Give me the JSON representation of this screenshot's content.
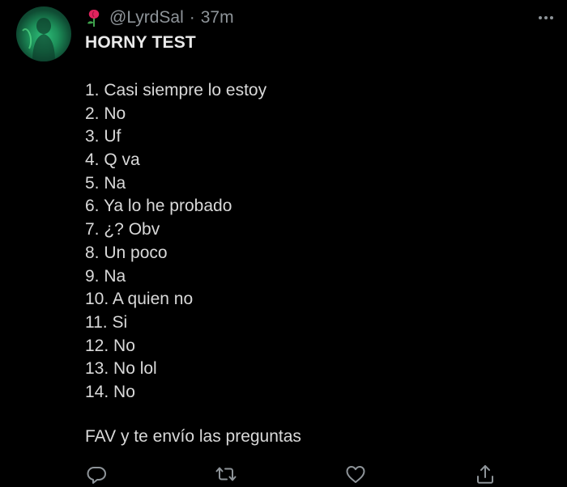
{
  "tweet": {
    "avatar_icon": "user-avatar",
    "author_emoji": "rose-icon",
    "handle": "@LyrdSal",
    "separator": "·",
    "timestamp": "37m",
    "title": "HORNY TEST",
    "answers": [
      "1. Casi siempre lo estoy",
      "2. No",
      "3. Uf",
      "4. Q va",
      "5. Na",
      "6. Ya lo he probado",
      "7. ¿? Obv",
      "8. Un poco",
      "9. Na",
      "10. A quien no",
      "11. Si",
      "12. No",
      "13. No lol",
      "14. No"
    ],
    "footer": "FAV y te envío las preguntas"
  },
  "actions": {
    "reply_icon": "reply-icon",
    "retweet_icon": "retweet-icon",
    "like_icon": "heart-icon",
    "share_icon": "share-icon"
  },
  "colors": {
    "background": "#000000",
    "text": "#d9d9d9",
    "muted": "#8e9499"
  }
}
